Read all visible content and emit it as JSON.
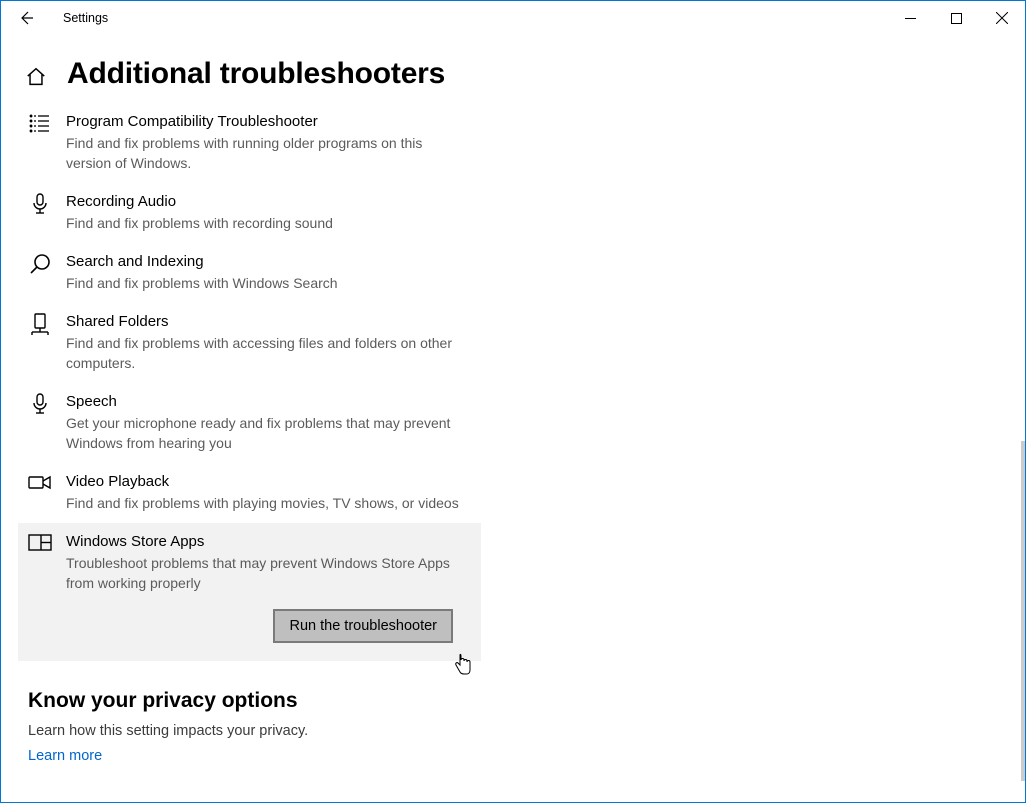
{
  "app": {
    "title": "Settings"
  },
  "page": {
    "heading": "Additional troubleshooters"
  },
  "troubleshooters": [
    {
      "id": "program-compat",
      "title": "Program Compatibility Troubleshooter",
      "desc": "Find and fix problems with running older programs on this version of Windows."
    },
    {
      "id": "recording-audio",
      "title": "Recording Audio",
      "desc": "Find and fix problems with recording sound"
    },
    {
      "id": "search-indexing",
      "title": "Search and Indexing",
      "desc": "Find and fix problems with Windows Search"
    },
    {
      "id": "shared-folders",
      "title": "Shared Folders",
      "desc": "Find and fix problems with accessing files and folders on other computers."
    },
    {
      "id": "speech",
      "title": "Speech",
      "desc": "Get your microphone ready and fix problems that may prevent Windows from hearing you"
    },
    {
      "id": "video-playback",
      "title": "Video Playback",
      "desc": "Find and fix problems with playing movies, TV shows, or videos"
    },
    {
      "id": "store-apps",
      "title": "Windows Store Apps",
      "desc": "Troubleshoot problems that may prevent Windows Store Apps from working properly"
    }
  ],
  "selected_index": 6,
  "run_button": {
    "label": "Run the troubleshooter"
  },
  "privacy": {
    "heading": "Know your privacy options",
    "desc": "Learn how this setting impacts your privacy.",
    "link": "Learn more"
  }
}
